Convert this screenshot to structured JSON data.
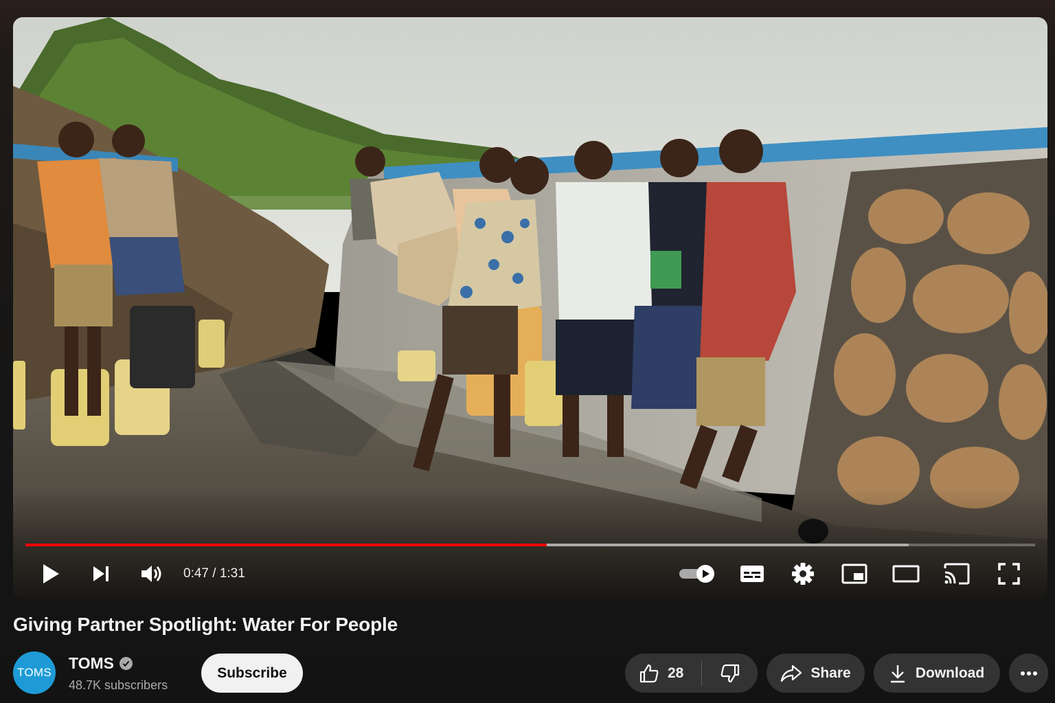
{
  "player": {
    "current_time": "0:47",
    "duration": "1:31",
    "played_fraction": 0.516,
    "buffered_fraction": 0.875,
    "accent_color": "#ff0000",
    "autoplay_on": true
  },
  "controls": {
    "left": [
      "play-icon",
      "next-icon",
      "volume-icon"
    ],
    "right": [
      "autoplay-toggle-icon",
      "subtitles-icon",
      "settings-gear-icon",
      "miniplayer-icon",
      "theater-mode-icon",
      "cast-icon",
      "fullscreen-icon"
    ]
  },
  "video": {
    "title": "Giving Partner Spotlight: Water For People"
  },
  "channel": {
    "avatar_text": "TOMS",
    "avatar_color": "#1e9bd7",
    "name": "TOMS",
    "verified": true,
    "subscribers": "48.7K subscribers"
  },
  "actions": {
    "subscribe_label": "Subscribe",
    "like_count": "28",
    "share_label": "Share",
    "download_label": "Download"
  }
}
